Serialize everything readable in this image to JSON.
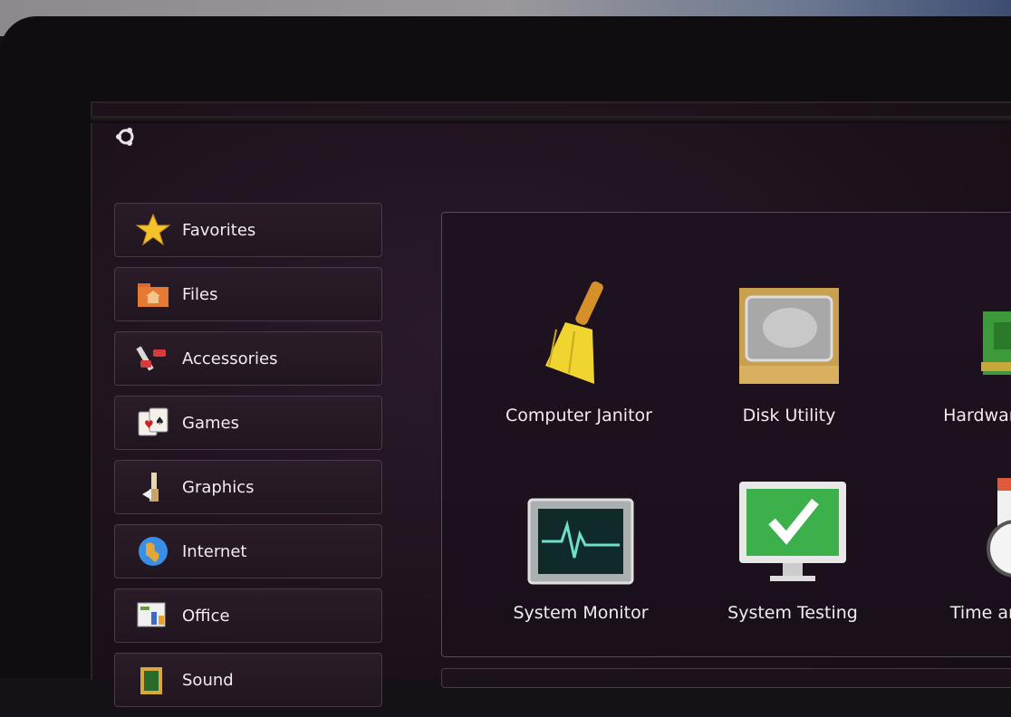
{
  "menu": {
    "logo_icon": "ubuntu-logo-icon",
    "categories": [
      {
        "label": "Favorites",
        "icon": "star-icon"
      },
      {
        "label": "Files",
        "icon": "folder-icon"
      },
      {
        "label": "Accessories",
        "icon": "accessories-icon"
      },
      {
        "label": "Games",
        "icon": "playing-cards-icon"
      },
      {
        "label": "Graphics",
        "icon": "graphics-icon"
      },
      {
        "label": "Internet",
        "icon": "globe-icon"
      },
      {
        "label": "Office",
        "icon": "office-icon"
      },
      {
        "label": "Sound",
        "icon": "sound-icon"
      }
    ]
  },
  "apps": [
    {
      "label": "Computer Janitor",
      "icon": "broom-icon"
    },
    {
      "label": "Disk Utility",
      "icon": "hard-disk-icon"
    },
    {
      "label": "Hardware",
      "icon": "circuit-board-icon"
    },
    {
      "label": "System Monitor",
      "icon": "system-monitor-icon"
    },
    {
      "label": "System Testing",
      "icon": "checkmark-monitor-icon"
    },
    {
      "label": "Time an",
      "icon": "clock-calendar-icon"
    }
  ],
  "colors": {
    "background": "#1d121c",
    "text": "#f1ecf1",
    "border": "#4a3a48",
    "accent_green": "#3cb04a"
  }
}
